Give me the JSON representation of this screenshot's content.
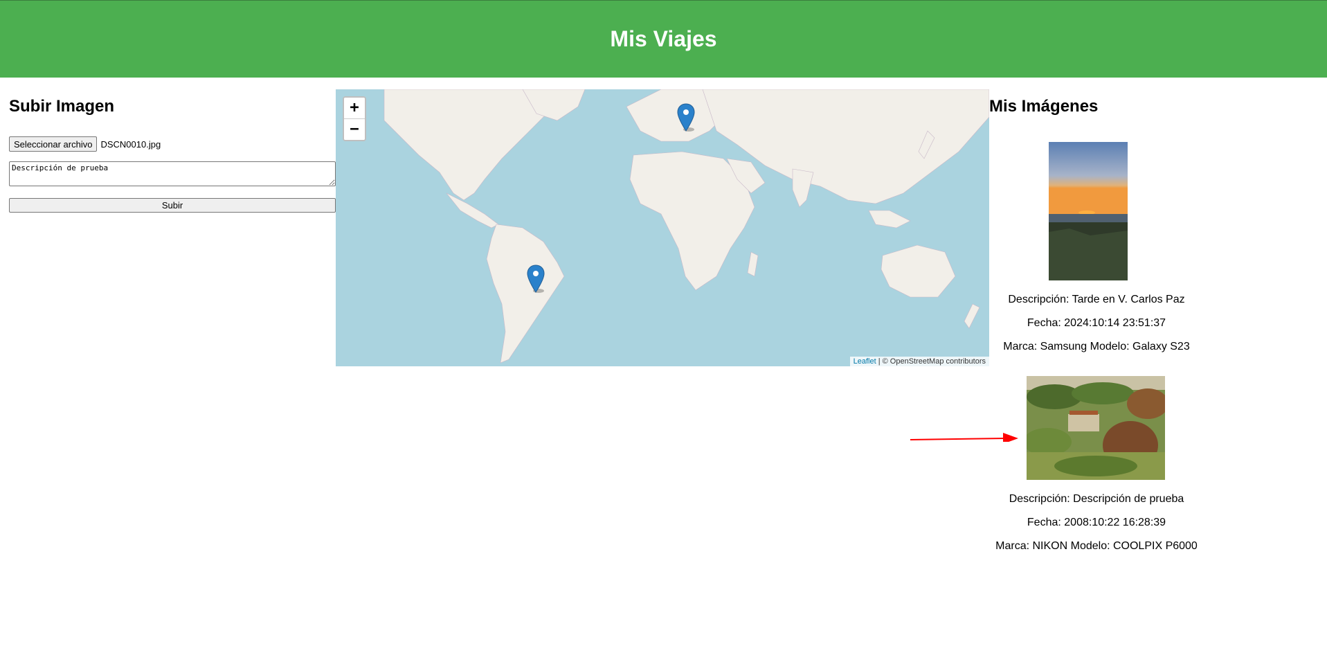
{
  "header": {
    "title": "Mis Viajes"
  },
  "upload": {
    "title": "Subir Imagen",
    "file_button_label": "Seleccionar archivo",
    "file_name": "DSCN0010.jpg",
    "description_value": "Descripción de prueba",
    "submit_label": "Subir"
  },
  "map": {
    "zoom_in_label": "+",
    "zoom_out_label": "−",
    "attribution_link": "Leaflet",
    "attribution_text": " | © OpenStreetMap contributors",
    "markers": [
      {
        "name": "Europe"
      },
      {
        "name": "Argentina"
      }
    ]
  },
  "gallery": {
    "title": "Mis Imágenes",
    "items": [
      {
        "description": "Descripción: Tarde en V. Carlos Paz",
        "date": "Fecha: 2024:10:14 23:51:37",
        "camera": "Marca: Samsung Modelo: Galaxy S23"
      },
      {
        "description": "Descripción: Descripción de prueba",
        "date": "Fecha: 2008:10:22 16:28:39",
        "camera": "Marca: NIKON Modelo: COOLPIX P6000"
      }
    ]
  },
  "colors": {
    "header_bg": "#4caf50",
    "ocean": "#aad3df",
    "land": "#f2efe9",
    "marker": "#2a81cb",
    "annotation_arrow": "#ff0000"
  }
}
